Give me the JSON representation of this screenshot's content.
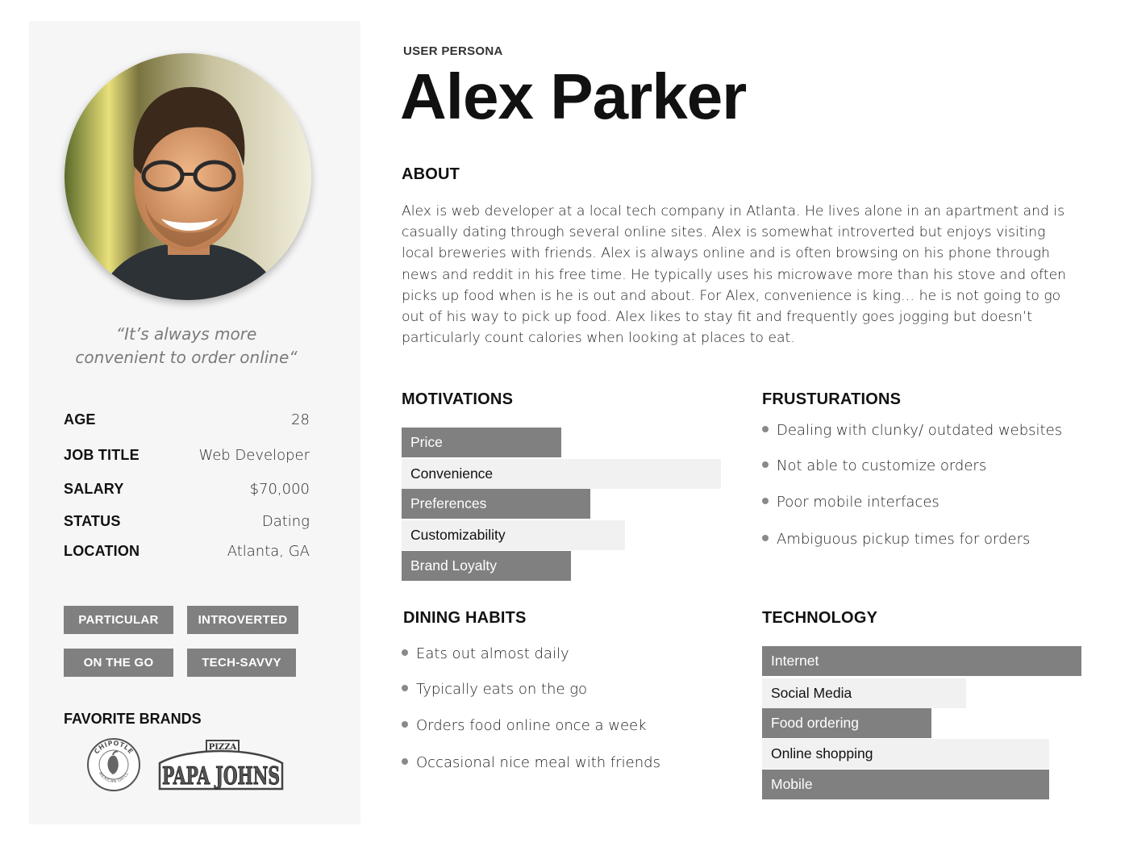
{
  "header": {
    "eyebrow": "USER PERSONA",
    "name": "Alex Parker"
  },
  "sidebar": {
    "quote_line1": "“It’s always more",
    "quote_line2": "convenient to order online“",
    "stats": [
      {
        "label": "AGE",
        "value": "28"
      },
      {
        "label": "JOB TITLE",
        "value": "Web Developer"
      },
      {
        "label": "SALARY",
        "value": "$70,000"
      },
      {
        "label": "STATUS",
        "value": "Dating"
      },
      {
        "label": "LOCATION",
        "value": "Atlanta, GA"
      }
    ],
    "traits": [
      "PARTICULAR",
      "INTROVERTED",
      "ON THE GO",
      "TECH-SAVVY"
    ],
    "brands_title": "FAVORITE BRANDS",
    "brands": {
      "chipotle_top": "CHIPOTLE",
      "chipotle_bottom": "MEXICAN GRILL",
      "papa_top": "PIZZA",
      "papa_main": "PAPA JOHNS"
    }
  },
  "about": {
    "title": "ABOUT",
    "lines": [
      "Alex is web developer at a local tech company in Atlanta. He lives alone in an apartment and is",
      "casually dating through several online sites. Alex is somewhat introverted but enjoys visiting",
      "local breweries with friends. Alex is always online and is often browsing on his phone through",
      "news and reddit in his free time. He typically uses his microwave more than his stove and often",
      "picks up food when is he is out and about. For Alex, convenience is king… he is not going to go",
      "out of his way to pick up food. Alex likes to stay fit and frequently goes jogging but doesn’t",
      "particularly count calories when looking at places to eat."
    ]
  },
  "motivations": {
    "title": "MOTIVATIONS",
    "items": [
      {
        "label": "Price",
        "level": 0.5
      },
      {
        "label": "Convenience",
        "level": 1.0
      },
      {
        "label": "Preferences",
        "level": 0.59
      },
      {
        "label": "Customizability",
        "level": 0.7
      },
      {
        "label": "Brand Loyalty",
        "level": 0.53
      }
    ]
  },
  "frustrations": {
    "title": "FRUSTURATIONS",
    "items": [
      "Dealing with clunky/ outdated websites",
      "Not able to customize orders",
      "Poor mobile  interfaces",
      "Ambiguous pickup times for orders"
    ]
  },
  "dining": {
    "title": "DINING HABITS",
    "items": [
      "Eats out almost daily",
      "Typically eats on the go",
      "Orders food online once a week",
      "Occasional nice meal with friends"
    ]
  },
  "technology": {
    "title": "TECHNOLOGY",
    "items": [
      {
        "label": "Internet",
        "level": 1.0
      },
      {
        "label": "Social Media",
        "level": 0.64
      },
      {
        "label": "Food ordering",
        "level": 0.53
      },
      {
        "label": "Online shopping",
        "level": 0.9
      },
      {
        "label": "Mobile",
        "level": 0.9
      }
    ]
  },
  "colors": {
    "bar_dark": "#808080",
    "bar_light": "#f1f1f1",
    "sidebar_bg": "#f6f6f6"
  }
}
